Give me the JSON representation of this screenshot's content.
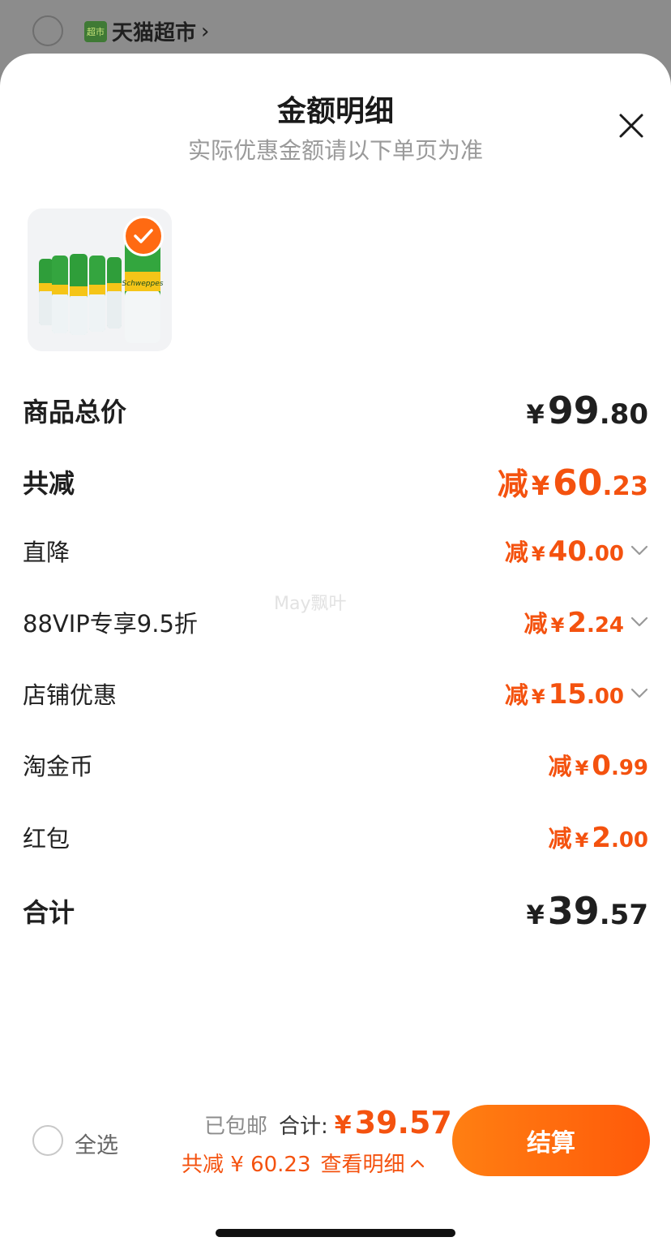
{
  "background": {
    "store_name": "天猫超市",
    "store_badge": "超市",
    "chevron": "›"
  },
  "sheet": {
    "title": "金额明细",
    "subtitle": "实际优惠金额请以下单页为准",
    "close_icon": "close-icon"
  },
  "product": {
    "selected": true,
    "brand_on_bottle": "Schweppes"
  },
  "rows": {
    "subtotal": {
      "label": "商品总价",
      "currency": "¥",
      "int": "99",
      "dec": ".80"
    },
    "total_discount": {
      "label": "共减",
      "prefix": "减",
      "currency": "¥",
      "int": "60",
      "dec": ".23"
    },
    "direct": {
      "label": "直降",
      "prefix": "减",
      "currency": "¥",
      "int": "40",
      "dec": ".00"
    },
    "vip": {
      "label": "88VIP专享9.5折",
      "prefix": "减",
      "currency": "¥",
      "int": "2",
      "dec": ".24"
    },
    "store": {
      "label": "店铺优惠",
      "prefix": "减",
      "currency": "¥",
      "int": "15",
      "dec": ".00"
    },
    "coins": {
      "label": "淘金币",
      "prefix": "减",
      "currency": "¥",
      "int": "0",
      "dec": ".99"
    },
    "redpacket": {
      "label": "红包",
      "prefix": "减",
      "currency": "¥",
      "int": "2",
      "dec": ".00"
    },
    "total": {
      "label": "合计",
      "currency": "¥",
      "int": "39",
      "dec": ".57"
    }
  },
  "watermark": "May飘叶",
  "footer": {
    "select_all": "全选",
    "shipping": "已包邮",
    "total_label": "合计:",
    "currency": "¥",
    "total_value": "39.57",
    "discount_text": "共减 ¥ 60.23",
    "details_link": "查看明细",
    "checkout_label": "结算"
  },
  "colors": {
    "accent": "#f4520f",
    "checkout_gradient_start": "#ff7f12",
    "checkout_gradient_end": "#ff5a0a"
  }
}
